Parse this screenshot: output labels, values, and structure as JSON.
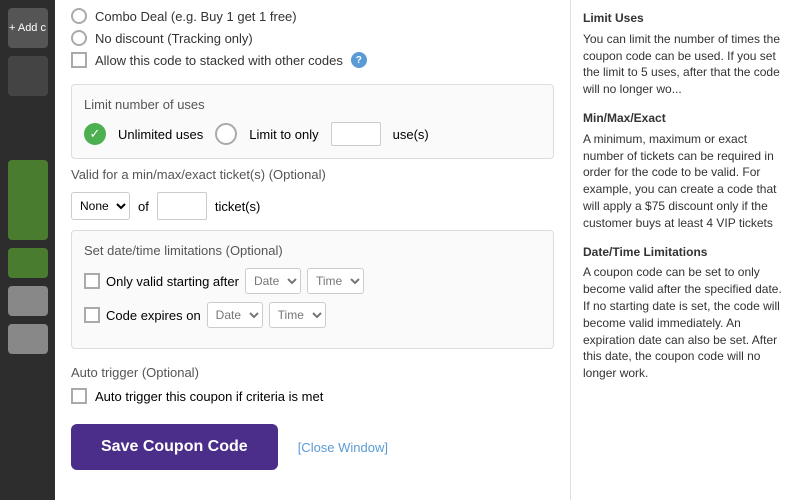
{
  "sidebar": {
    "addLabel": "+ Add c"
  },
  "discountOptions": {
    "comboLabel": "Combo Deal (e.g. Buy 1 get 1 free)",
    "noDiscountLabel": "No discount (Tracking only)",
    "stackLabel": "Allow this code to stacked with other codes"
  },
  "limitUses": {
    "sectionTitle": "Limit number of uses",
    "unlimitedLabel": "Unlimited uses",
    "limitToLabel": "Limit to only",
    "usesSuffix": "use(s)"
  },
  "tickets": {
    "sectionTitle": "Valid for a min/max/exact ticket(s) (Optional)",
    "noneOption": "None",
    "ofLabel": "of",
    "ticketsSuffix": "ticket(s)",
    "noneValue": ""
  },
  "dateTime": {
    "sectionTitle": "Set date/time limitations (Optional)",
    "startingLabel": "Only valid starting after",
    "expiresLabel": "Code expires on",
    "datePlaceholder": "Date",
    "timePlaceholder": "Time"
  },
  "autoTrigger": {
    "sectionTitle": "Auto trigger (Optional)",
    "checkboxLabel": "Auto trigger this coupon if criteria is met"
  },
  "saveButton": {
    "label": "Save Coupon Code"
  },
  "closeLink": {
    "label": "[Close Window]"
  },
  "infoPanel": {
    "limitUsesTitle": "Limit Uses",
    "limitUsesText": "You can limit the number of times the coupon code can be used. If you set the limit to 5 uses, after that the code will no longer wo...",
    "minMaxTitle": "Min/Max/Exact",
    "minMaxText": "A minimum, maximum or exact number of tickets can be required in order for the code to be valid. For example, you can create a code that will apply a $75 discount only if the customer buys at least 4 VIP tickets",
    "dateTimeTitle": "Date/Time Limitations",
    "dateTimeText": "A coupon code can be set to only become valid after the specified date. If no starting date is set, the code will become valid immediately. An expiration date can also be set. After this date, the coupon code will no longer work."
  }
}
